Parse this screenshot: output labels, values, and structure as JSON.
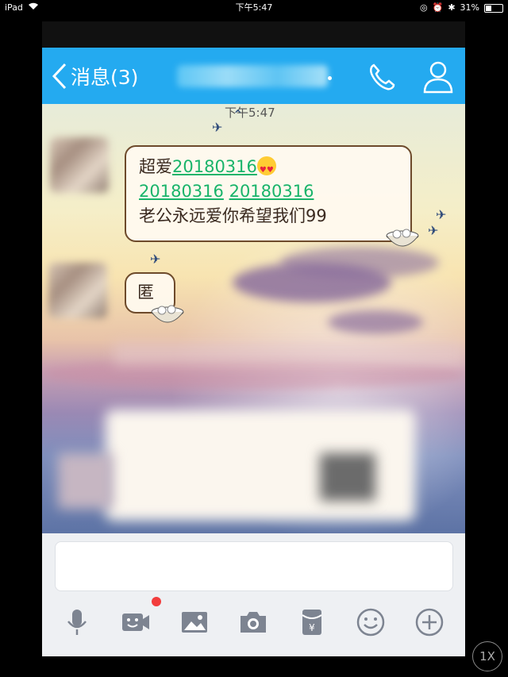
{
  "status_bar": {
    "device": "iPad",
    "time": "下午5:47",
    "battery": "31%"
  },
  "nav": {
    "back_label": "消息(3)"
  },
  "chat": {
    "timestamp": "下午5:47",
    "messages": [
      {
        "line1_text": "超爱",
        "line1_link": "20180316",
        "line2_link1": "20180316",
        "line2_link2": "20180316",
        "line3_text": "老公永远爱你希望我们99"
      },
      {
        "text": "匿"
      }
    ]
  },
  "toolbar": {
    "icons": [
      "microphone-icon",
      "video-call-icon",
      "image-icon",
      "camera-icon",
      "red-packet-icon",
      "emoji-icon",
      "plus-icon"
    ]
  },
  "overlay": {
    "speed": "1X"
  },
  "colors": {
    "nav_bg": "#24aaf0",
    "link": "#19b46a",
    "badge": "#f23d3d"
  }
}
